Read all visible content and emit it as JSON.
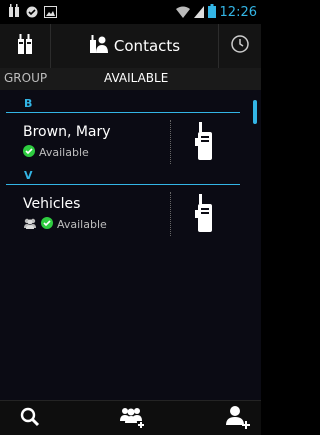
{
  "status_bar": {
    "time": "12:26",
    "icons": [
      "radio-notification-icon",
      "check-circle-icon",
      "image-icon",
      "wifi-icon",
      "signal-icon",
      "battery-icon"
    ]
  },
  "action_bar": {
    "title": "Contacts",
    "left_icon": "radio-icon",
    "right_icon": "clock-icon"
  },
  "tabs": [
    {
      "label": "GROUP",
      "selected": false
    },
    {
      "label": "AVAILABLE",
      "selected": true
    }
  ],
  "sections": [
    {
      "letter": "B",
      "contacts": [
        {
          "name": "Brown, Mary",
          "status": "Available"
        }
      ]
    },
    {
      "letter": "V",
      "contacts": [
        {
          "name": "Vehicles",
          "status": "Available"
        }
      ]
    }
  ],
  "bottom_bar": {
    "buttons": [
      "search-icon",
      "add-group-icon",
      "add-contact-icon"
    ]
  },
  "colors": {
    "accent": "#33b5e5",
    "available": "#2ecc40"
  }
}
